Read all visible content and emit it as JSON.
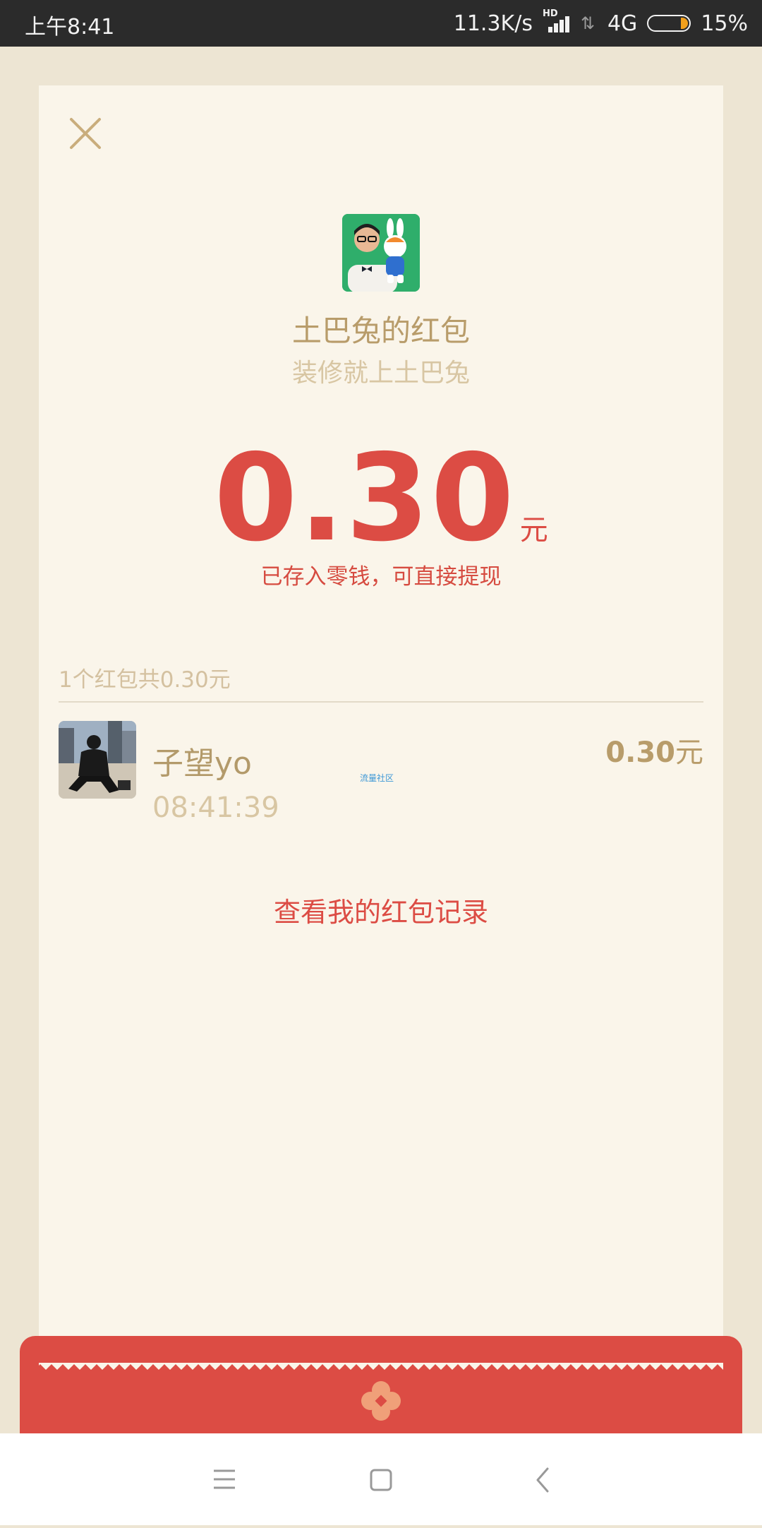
{
  "status_bar": {
    "time": "上午8:41",
    "speed": "11.3K/s",
    "hd_label": "HD",
    "network": "4G",
    "battery": "15%",
    "battery_level": 0.15
  },
  "sender": {
    "title": "土巴兔的红包",
    "subtitle": "装修就上土巴兔"
  },
  "amount": {
    "value": "0.30",
    "unit": "元",
    "note": "已存入零钱，可直接提现"
  },
  "summary": "1个红包共0.30元",
  "receivers": [
    {
      "name": "子望yo",
      "time": "08:41:39",
      "amount": "0.30",
      "unit": "元"
    }
  ],
  "watermark": "流量社区",
  "records_link": "查看我的红包记录",
  "colors": {
    "accent_red": "#dc4c44",
    "gold": "#b89c6a",
    "card_bg": "#faf5ea",
    "page_bg": "#ede5d3"
  },
  "icons": {
    "close": "close-icon",
    "menu": "menu-icon",
    "home": "home-icon",
    "back": "back-icon",
    "seal": "seal-icon"
  }
}
